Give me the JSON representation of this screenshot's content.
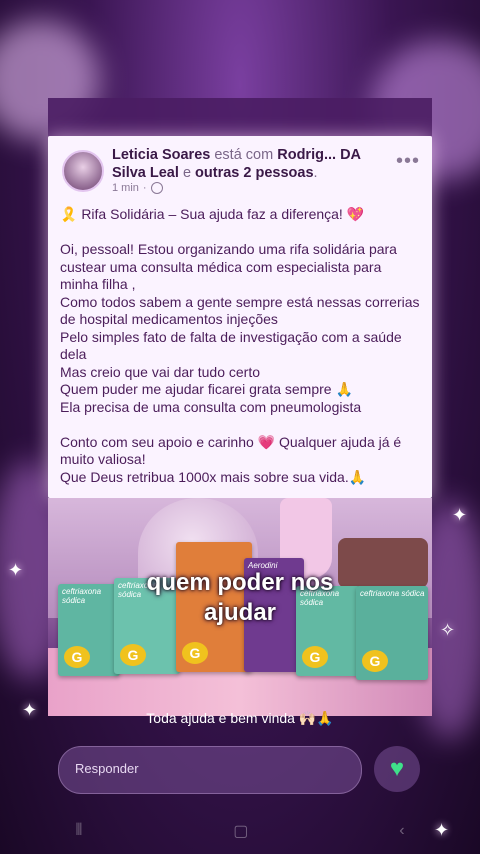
{
  "post": {
    "author": "Leticia Soares",
    "with_text": "está com",
    "tagged": "Rodrig... DA Silva Leal",
    "and_text": "e",
    "others": "outras 2 pessoas",
    "period": ".",
    "time": "1 min",
    "more": "•••",
    "lines": [
      "🎗️ Rifa Solidária – Sua ajuda faz a diferença! 💖",
      "",
      "Oi, pessoal! Estou organizando uma rifa solidária para custear uma consulta médica com especialista para minha filha ,",
      "Como todos sabem a gente sempre está nessas correrias de hospital medicamentos injeções",
      "Pelo simples fato de falta de investigação com a saúde dela",
      "Mas creio que vai dar tudo certo",
      "Quem puder me ajudar ficarei grata sempre 🙏",
      "Ela precisa de uma consulta com pneumologista",
      "",
      "Conto com seu apoio e carinho 💗 Qualquer ajuda já é muito valiosa!",
      "Que Deus retribua 1000x mais sobre sua vida.🙏"
    ]
  },
  "photo": {
    "overlay_line1": "quem poder nos",
    "overlay_line2": "ajudar",
    "box_brand": "ceftriaxona sódica",
    "box_mid": "Aerodini",
    "generic_letter": "G"
  },
  "caption": "Toda ajuda e bem vinda 🙌🏻🙏",
  "reply": {
    "placeholder": "Responder"
  },
  "icons": {
    "heart": "green-heart-icon",
    "globe": "globe-icon",
    "more": "more-options-icon"
  },
  "colors": {
    "accent_text": "#4b1d5a",
    "heart": "#3fe08a"
  }
}
